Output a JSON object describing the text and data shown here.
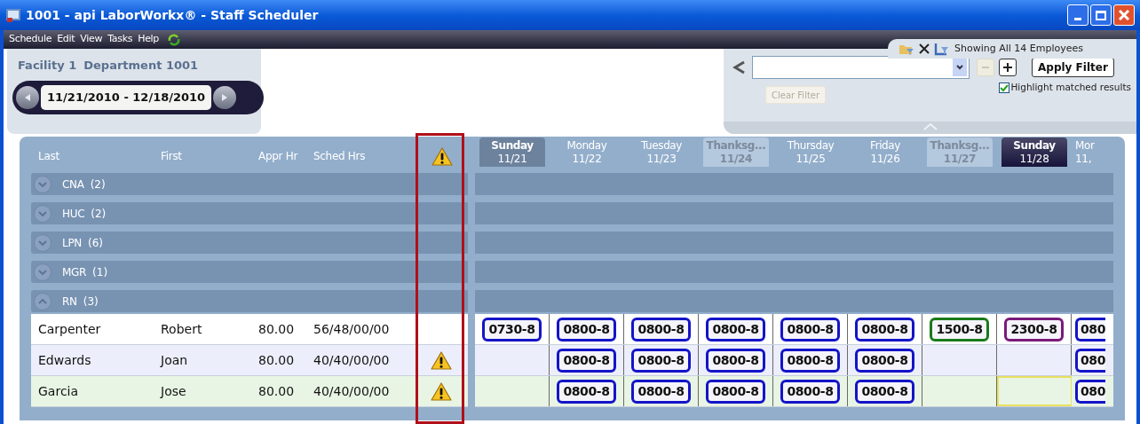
{
  "window": {
    "title": "1001 - api LaborWorkx® - Staff Scheduler"
  },
  "menu": [
    "Schedule",
    "Edit",
    "View",
    "Tasks",
    "Help"
  ],
  "location": {
    "facility": "Facility 1",
    "department": "Department 1001"
  },
  "date_range": "11/21/2010 - 12/18/2010",
  "filter": {
    "status": "Showing All 14 Employees",
    "remove_disabled": true,
    "apply_label": "Apply Filter",
    "clear_label": "Clear Filter",
    "clear_disabled": true,
    "highlight_checked": true,
    "highlight_label": "Highlight matched results"
  },
  "columns": [
    "Last",
    "First",
    "Appr Hr",
    "Sched Hrs"
  ],
  "days": [
    {
      "day": "Sunday",
      "date": "11/21",
      "kind": "current",
      "selected": false
    },
    {
      "day": "Monday",
      "date": "11/22",
      "kind": "normal",
      "selected": false
    },
    {
      "day": "Tuesday",
      "date": "11/23",
      "kind": "normal",
      "selected": false
    },
    {
      "day": "Thanksg...",
      "date": "11/24",
      "kind": "holiday",
      "selected": false
    },
    {
      "day": "Thursday",
      "date": "11/25",
      "kind": "normal",
      "selected": false
    },
    {
      "day": "Friday",
      "date": "11/26",
      "kind": "normal",
      "selected": false
    },
    {
      "day": "Thanksg...",
      "date": "11/27",
      "kind": "holiday",
      "selected": false
    },
    {
      "day": "Sunday",
      "date": "11/28",
      "kind": "normal",
      "selected": true
    },
    {
      "day": "Mor",
      "date": "11,",
      "kind": "normal",
      "selected": false
    }
  ],
  "groups": [
    {
      "label": "CNA",
      "count": "(2)",
      "expanded": false
    },
    {
      "label": "HUC",
      "count": "(2)",
      "expanded": false
    },
    {
      "label": "LPN",
      "count": "(6)",
      "expanded": false
    },
    {
      "label": "MGR",
      "count": "(1)",
      "expanded": false
    },
    {
      "label": "RN",
      "count": "(3)",
      "expanded": true
    }
  ],
  "employees": [
    {
      "last": "Carpenter",
      "first": "Robert",
      "appr": "80.00",
      "sched": "56/48/00/00",
      "warning": false,
      "color": "#ffffff",
      "shifts": [
        {
          "text": "0730-8",
          "color": "#1414c8",
          "selected": false
        },
        {
          "text": "0800-8",
          "color": "#1414c8",
          "selected": false
        },
        {
          "text": "0800-8",
          "color": "#1414c8",
          "selected": false
        },
        {
          "text": "0800-8",
          "color": "#1414c8",
          "selected": false
        },
        {
          "text": "0800-8",
          "color": "#1414c8",
          "selected": false
        },
        {
          "text": "0800-8",
          "color": "#1414c8",
          "selected": false
        },
        {
          "text": "1500-8",
          "color": "#1a7a1a",
          "selected": false
        },
        {
          "text": "2300-8",
          "color": "#7a1a7a",
          "selected": false
        },
        {
          "text": "080",
          "color": "#1414c8",
          "selected": false
        }
      ]
    },
    {
      "last": "Edwards",
      "first": "Joan",
      "appr": "80.00",
      "sched": "40/40/00/00",
      "warning": true,
      "color": "#eceffb",
      "shifts": [
        {
          "selected": false
        },
        {
          "text": "0800-8",
          "color": "#1414c8",
          "selected": false
        },
        {
          "text": "0800-8",
          "color": "#1414c8",
          "selected": false
        },
        {
          "text": "0800-8",
          "color": "#1414c8",
          "selected": false
        },
        {
          "text": "0800-8",
          "color": "#1414c8",
          "selected": false
        },
        {
          "text": "0800-8",
          "color": "#1414c8",
          "selected": false
        },
        {
          "selected": false
        },
        {
          "selected": false
        },
        {
          "text": "080",
          "color": "#1414c8",
          "selected": false
        }
      ]
    },
    {
      "last": "Garcia",
      "first": "Jose",
      "appr": "80.00",
      "sched": "40/40/00/00",
      "warning": true,
      "color": "#e8f5e4",
      "shifts": [
        {
          "selected": false
        },
        {
          "text": "0800-8",
          "color": "#1414c8",
          "selected": false
        },
        {
          "text": "0800-8",
          "color": "#1414c8",
          "selected": false
        },
        {
          "text": "0800-8",
          "color": "#1414c8",
          "selected": false
        },
        {
          "text": "0800-8",
          "color": "#1414c8",
          "selected": false
        },
        {
          "text": "0800-8",
          "color": "#1414c8",
          "selected": false
        },
        {
          "selected": false
        },
        {
          "selected": true
        },
        {
          "text": "080",
          "color": "#1414c8",
          "selected": false
        }
      ]
    }
  ]
}
